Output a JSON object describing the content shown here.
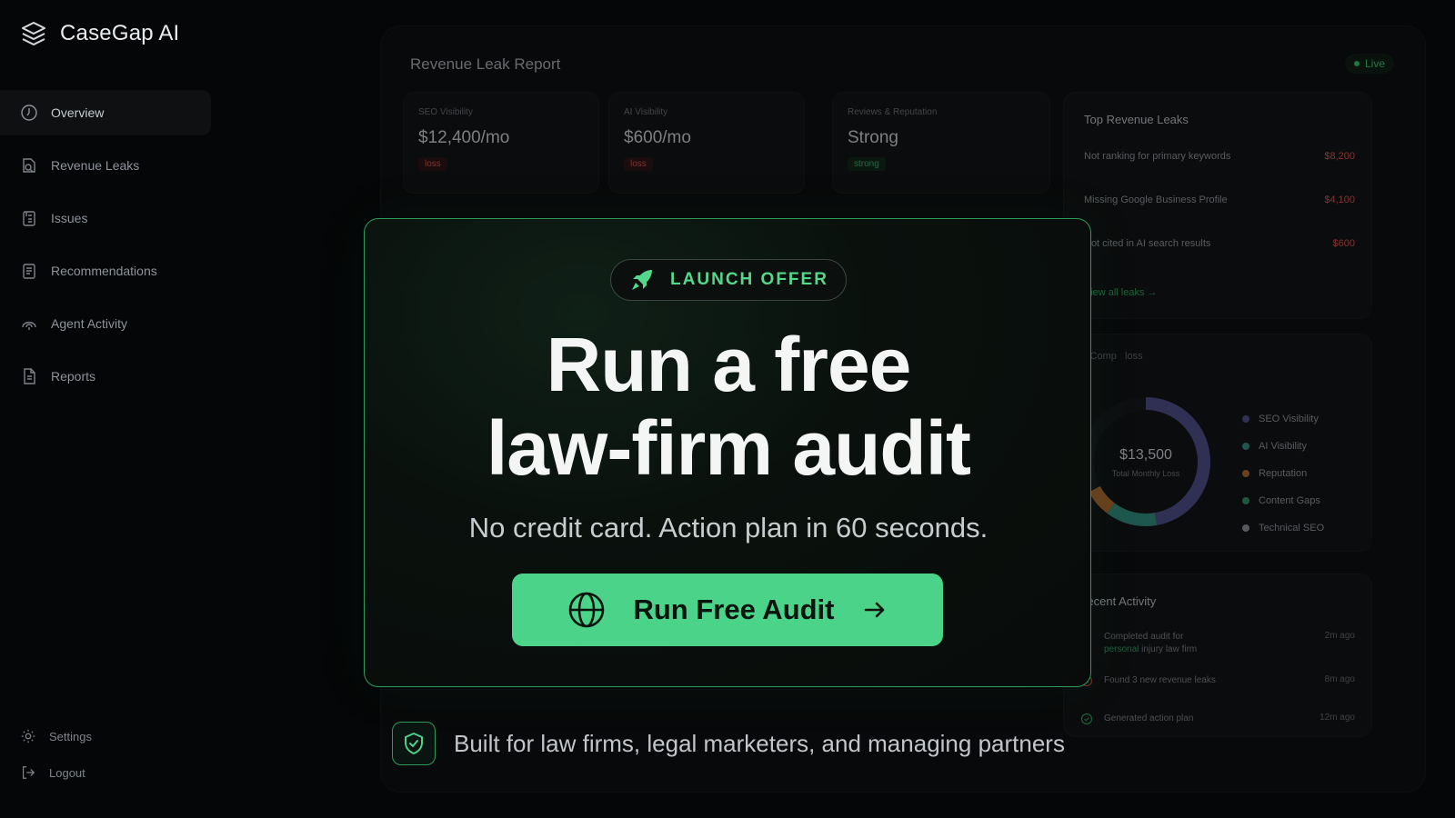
{
  "brand": {
    "name": "CaseGap AI"
  },
  "sidebar": {
    "items": [
      {
        "label": "Overview",
        "icon": "overview-icon",
        "active": true
      },
      {
        "label": "Revenue Leaks",
        "icon": "revenue-leaks-icon"
      },
      {
        "label": "Issues",
        "icon": "issues-icon"
      },
      {
        "label": "Recommendations",
        "icon": "recommendations-icon"
      },
      {
        "label": "Agent Activity",
        "icon": "agent-activity-icon"
      },
      {
        "label": "Reports",
        "icon": "reports-icon"
      }
    ],
    "settings_label": "Settings",
    "logout_label": "Logout"
  },
  "dashboard": {
    "title": "Revenue Leak Report",
    "live_label": "Live",
    "metrics": [
      {
        "label": "SEO Visibility",
        "value": "$12,400/mo",
        "badge": "loss"
      },
      {
        "label": "AI Visibility",
        "value": "$600/mo",
        "badge": "loss"
      },
      {
        "label": "Reviews & Reputation",
        "value": "Strong",
        "badge": "strong"
      }
    ],
    "top_leaks": {
      "title": "Top Revenue Leaks",
      "rows": [
        {
          "label": "Not ranking for primary keywords",
          "amount": "$8,200"
        },
        {
          "label": "Missing Google Business Profile",
          "amount": "$4,100"
        },
        {
          "label": "Not cited in AI search results",
          "amount": "$600"
        }
      ],
      "view_all": "View all leaks →"
    },
    "breakdown": {
      "label_a": "FerComp",
      "label_b": "loss",
      "center_value": "$13,500",
      "center_label": "Total Monthly Loss",
      "legend": [
        {
          "label": "SEO Visibility",
          "color": "#4b4a86"
        },
        {
          "label": "AI Visibility",
          "color": "#2e8a79"
        },
        {
          "label": "Reputation",
          "color": "#a5642a"
        },
        {
          "label": "Content Gaps",
          "color": "#2e8a5e"
        },
        {
          "label": "Technical SEO",
          "color": "#8a8d91"
        }
      ]
    },
    "activity": {
      "title": "Recent Activity",
      "rows": [
        {
          "text": "Completed audit for",
          "highlight": "personal",
          "text_after": " injury law firm",
          "time": "2m ago"
        },
        {
          "text": "Found 3 new revenue leaks",
          "time": "8m ago"
        },
        {
          "text": "Generated action plan",
          "time": "12m ago"
        }
      ]
    }
  },
  "modal": {
    "pill_label": "LAUNCH OFFER",
    "headline_line1": "Run a free",
    "headline_line2": "law-firm audit",
    "subhead": "No credit card. Action plan in 60 seconds.",
    "cta_label": "Run Free Audit",
    "accent_color": "#4cd38a"
  },
  "footer": {
    "built_for": "Built for law firms, legal marketers, and managing partners"
  }
}
